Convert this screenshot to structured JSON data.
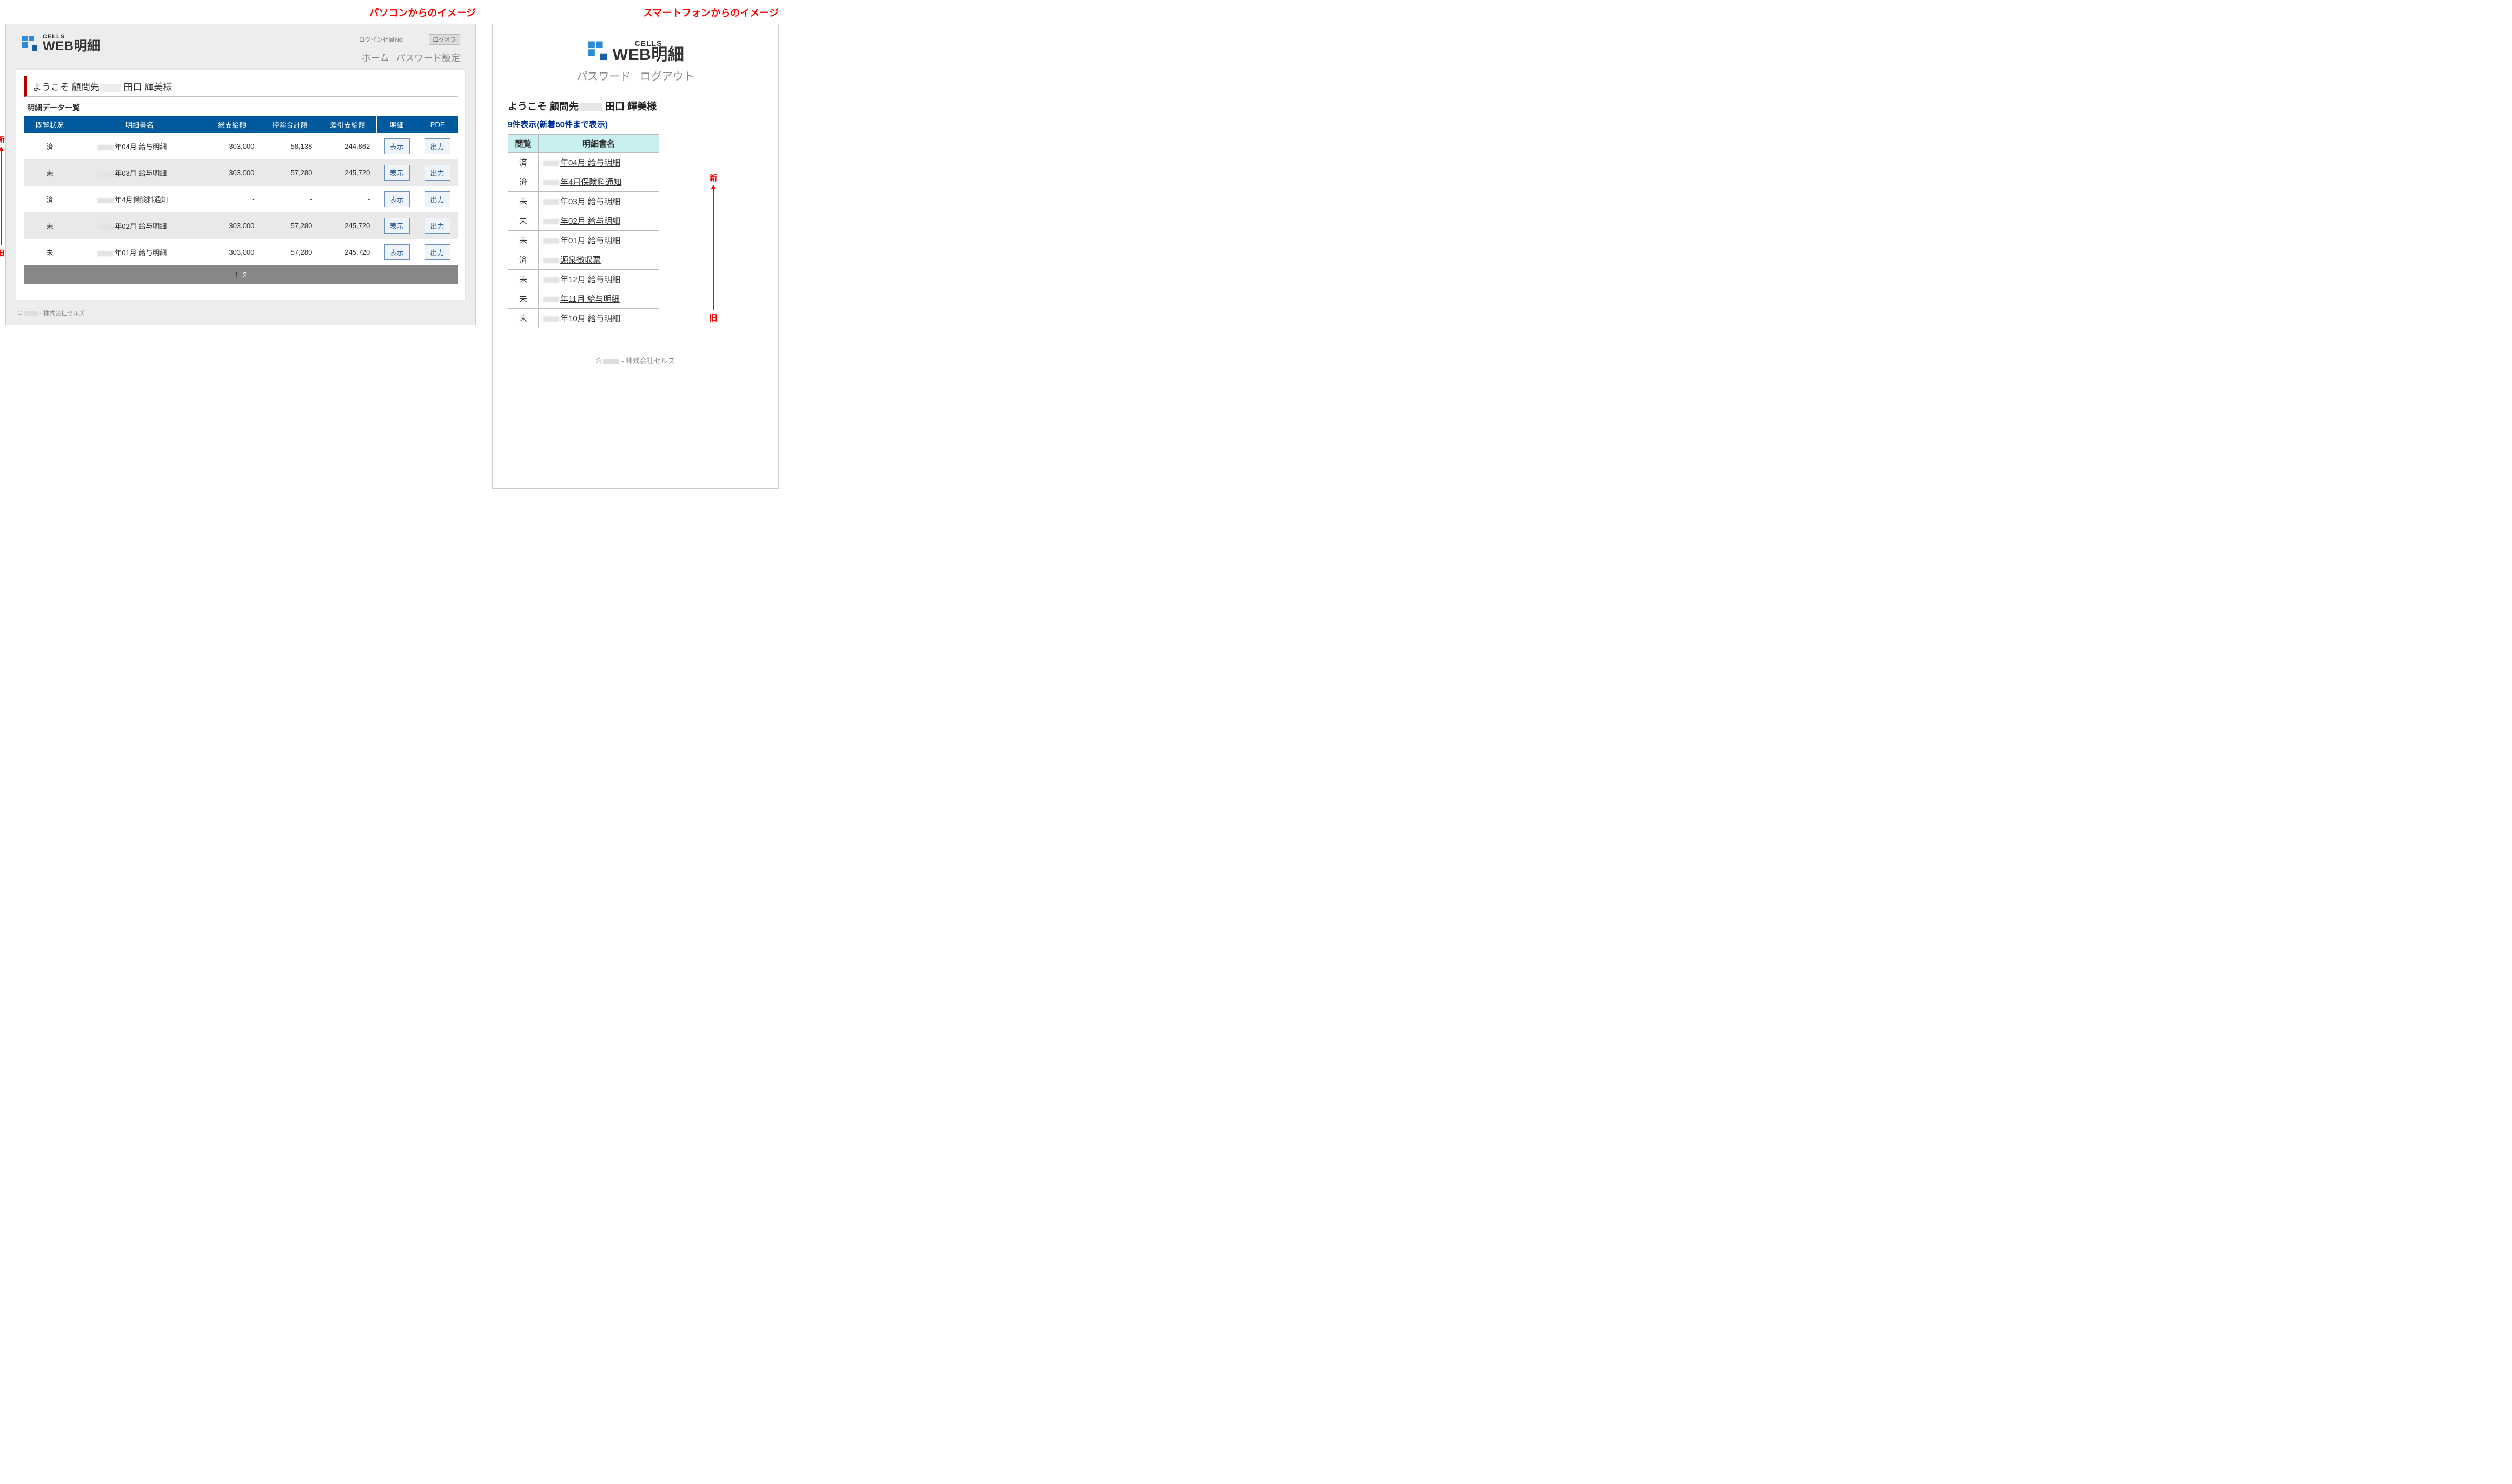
{
  "captions": {
    "pc": "パソコンからのイメージ",
    "mobile": "スマートフォンからのイメージ"
  },
  "annotation": {
    "new": "新",
    "old": "旧"
  },
  "logo": {
    "cells": "CELLS",
    "web": "WEB明細"
  },
  "pc": {
    "login_label": "ログイン社員No:",
    "logoff": "ログオフ",
    "nav_home": "ホーム",
    "nav_pw": "パスワード設定",
    "welcome_prefix": "ようこそ",
    "welcome_mid": "顧問先",
    "welcome_name": "田口 輝美様",
    "list_title": "明細データ一覧",
    "cols": {
      "status": "閲覧状況",
      "name": "明細書名",
      "gross": "総支給額",
      "deduct": "控除合計額",
      "net": "差引支給額",
      "detail": "明細",
      "pdf": "PDF"
    },
    "btn_show": "表示",
    "btn_out": "出力",
    "rows": [
      {
        "status": "済",
        "name": "年04月 給与明細",
        "gross": "303,000",
        "deduct": "58,138",
        "net": "244,862"
      },
      {
        "status": "未",
        "name": "年03月 給与明細",
        "gross": "303,000",
        "deduct": "57,280",
        "net": "245,720"
      },
      {
        "status": "済",
        "name": "年4月保険料通知",
        "gross": "-",
        "deduct": "-",
        "net": "-"
      },
      {
        "status": "未",
        "name": "年02月 給与明細",
        "gross": "303,000",
        "deduct": "57,280",
        "net": "245,720"
      },
      {
        "status": "未",
        "name": "年01月 給与明細",
        "gross": "303,000",
        "deduct": "57,280",
        "net": "245,720"
      }
    ],
    "pager_current": "1",
    "pager_next": "2",
    "footer_copy": "©",
    "footer_company": "- 株式会社セルズ"
  },
  "mobile": {
    "nav_pw": "パスワード",
    "nav_logout": "ログアウト",
    "welcome_prefix": "ようこそ",
    "welcome_mid": "顧問先",
    "welcome_name": "田口 輝美様",
    "count_line": "9件表示(新着50件まで表示)",
    "cols": {
      "status": "閲覧",
      "name": "明細書名"
    },
    "rows": [
      {
        "status": "済",
        "name": "年04月 給与明細"
      },
      {
        "status": "済",
        "name": "年4月保険料通知"
      },
      {
        "status": "未",
        "name": "年03月 給与明細"
      },
      {
        "status": "未",
        "name": "年02月 給与明細"
      },
      {
        "status": "未",
        "name": "年01月 給与明細"
      },
      {
        "status": "済",
        "name": "源泉徴収票"
      },
      {
        "status": "未",
        "name": "年12月 給与明細"
      },
      {
        "status": "未",
        "name": "年11月 給与明細"
      },
      {
        "status": "未",
        "name": "年10月 給与明細"
      }
    ],
    "footer_copy": "©",
    "footer_company": "- 株式会社セルズ"
  }
}
